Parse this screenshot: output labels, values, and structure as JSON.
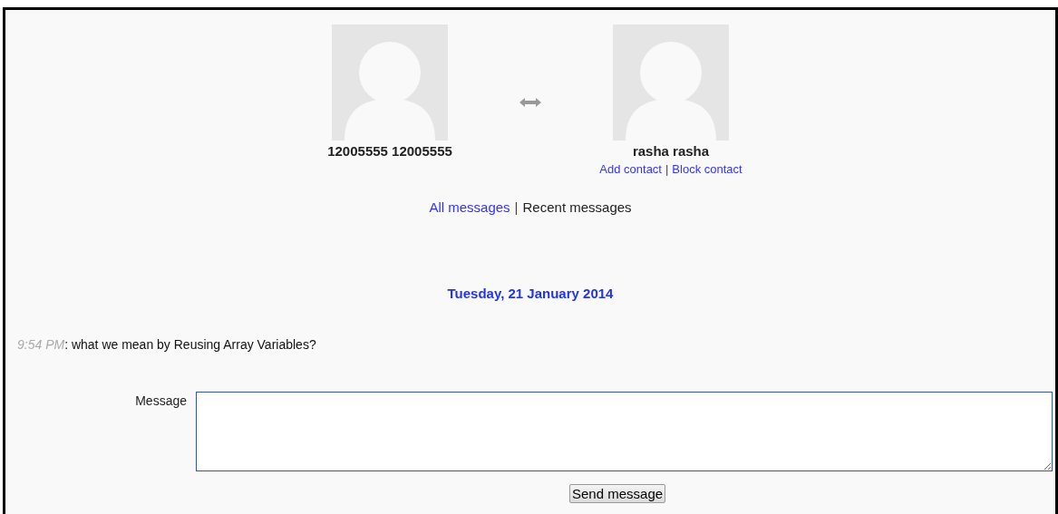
{
  "participants": [
    {
      "name": "12005555 12005555"
    },
    {
      "name": "rasha rasha",
      "links": [
        "Add contact",
        "Block contact"
      ]
    }
  ],
  "separator": "|",
  "views": [
    {
      "label": "All messages",
      "selected": false
    },
    {
      "label": "Recent messages",
      "selected": true
    }
  ],
  "date": "Tuesday, 21 January 2014",
  "messages": [
    {
      "time": "9:54 PM",
      "text": ": what we mean by Reusing Array Variables?"
    }
  ],
  "form": {
    "label": "Message",
    "button": "Send message"
  }
}
